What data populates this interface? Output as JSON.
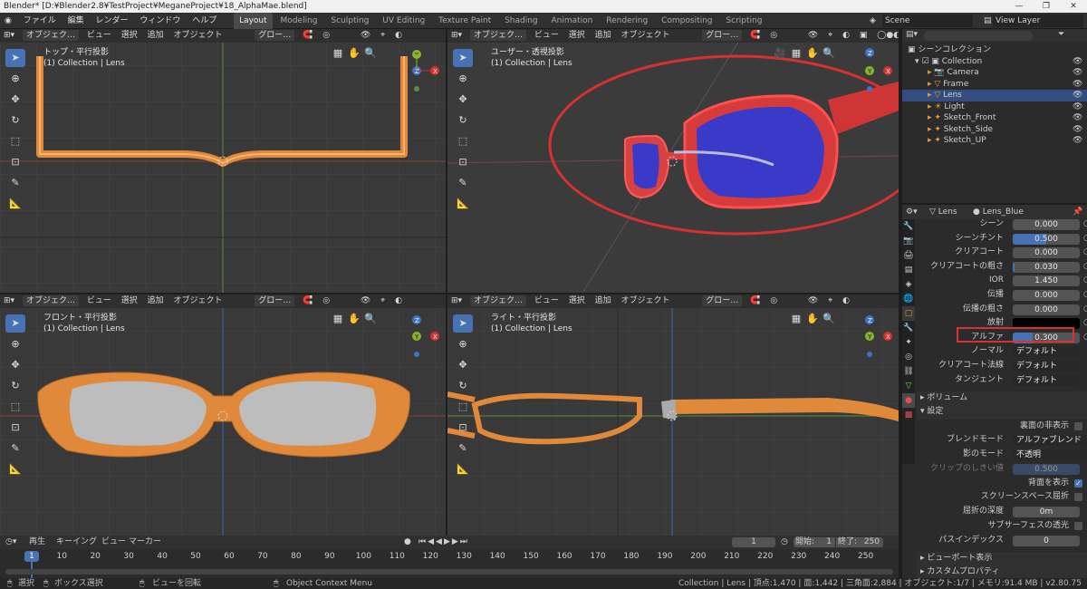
{
  "title": "Blender* [D:¥Blender2.8¥TestProject¥MeganeProject¥18_AlphaMae.blend]",
  "menu": [
    "ファイル",
    "編集",
    "レンダー",
    "ウィンドウ",
    "ヘルプ"
  ],
  "workspaces": [
    "Layout",
    "Modeling",
    "Sculpting",
    "UV Editing",
    "Texture Paint",
    "Shading",
    "Animation",
    "Rendering",
    "Compositing",
    "Scripting"
  ],
  "scene": "Scene",
  "view_layer": "View Layer",
  "vp_header": {
    "mode": "オブジェク…",
    "view": "ビュー",
    "select": "選択",
    "add": "追加",
    "object": "オブジェクト",
    "transform": "グロー…"
  },
  "viewports": [
    {
      "label": "トップ・平行投影",
      "sub": "(1) Collection | Lens"
    },
    {
      "label": "ユーザー・透視投影",
      "sub": "(1) Collection | Lens"
    },
    {
      "label": "フロント・平行投影",
      "sub": "(1) Collection | Lens"
    },
    {
      "label": "ライト・平行投影",
      "sub": "(1) Collection | Lens"
    }
  ],
  "outliner": {
    "root": "シーンコレクション",
    "items": [
      "Collection",
      "Camera",
      "Frame",
      "Lens",
      "Light",
      "Sketch_Front",
      "Sketch_Side",
      "Sketch_UP"
    ]
  },
  "props": {
    "object": "Lens",
    "material": "Lens_Blue",
    "rows": [
      {
        "label": "シーン",
        "value": "0.000",
        "fill": 0
      },
      {
        "label": "シーンチント",
        "value": "0.500",
        "fill": 0.5
      },
      {
        "label": "クリアコート",
        "value": "0.000",
        "fill": 0
      },
      {
        "label": "クリアコートの粗さ",
        "value": "0.030",
        "fill": 0.03
      },
      {
        "label": "IOR",
        "value": "1.450",
        "fill": 0
      },
      {
        "label": "伝播",
        "value": "0.000",
        "fill": 0
      },
      {
        "label": "伝播の粗さ",
        "value": "0.000",
        "fill": 0
      },
      {
        "label": "放射",
        "value": "",
        "fill": 0
      },
      {
        "label": "アルファ",
        "value": "0.300",
        "fill": 0.3
      },
      {
        "label": "ノーマル",
        "value": "デフォルト",
        "fill": 0
      },
      {
        "label": "クリアコート法線",
        "value": "デフォルト",
        "fill": 0
      },
      {
        "label": "タンジェント",
        "value": "デフォルト",
        "fill": 0
      }
    ],
    "volume": "ボリューム",
    "settings": "設定",
    "backface_hide": "裏面の非表示",
    "blend_mode_label": "ブレンドモード",
    "blend_mode": "アルファブレンド",
    "shadow_mode_label": "影のモード",
    "shadow_mode": "不透明",
    "clip_label": "クリップのしきい値",
    "clip_value": "0.500",
    "show_backface": "背面を表示",
    "ssr": "スクリーンスペース屈折",
    "refr_depth_label": "屈折の深度",
    "refr_depth": "0m",
    "sss": "サブサーフェスの透光",
    "pass_index_label": "パスインデックス",
    "pass_index": "0",
    "viewport_display": "ビューポート表示",
    "custom_props": "カスタムプロパティ"
  },
  "timeline": {
    "menu": [
      "再生",
      "キーイング",
      "ビュー",
      "マーカー"
    ],
    "frame": "1",
    "start_label": "開始:",
    "start": "1",
    "end_label": "終了:",
    "end": "250",
    "ticks": [
      "1",
      "10",
      "20",
      "30",
      "40",
      "50",
      "60",
      "70",
      "80",
      "90",
      "100",
      "110",
      "120",
      "130",
      "140",
      "150",
      "160",
      "170",
      "180",
      "190",
      "200",
      "210",
      "220",
      "230",
      "240",
      "250"
    ]
  },
  "status": {
    "select": "選択",
    "box": "ボックス選択",
    "rotate": "ビューを回転",
    "context": "Object Context Menu",
    "info": "Collection | Lens | 頂点:1,470 | 面:1,442 | 三角面:2,884 | オブジェクト:1/7 | メモリ:91.4 MB | v2.80.75"
  },
  "colors": {
    "accent": "#4772b3",
    "frame": "#e0893a",
    "lens_blue": "#3a3ac8",
    "red": "#d93030"
  }
}
